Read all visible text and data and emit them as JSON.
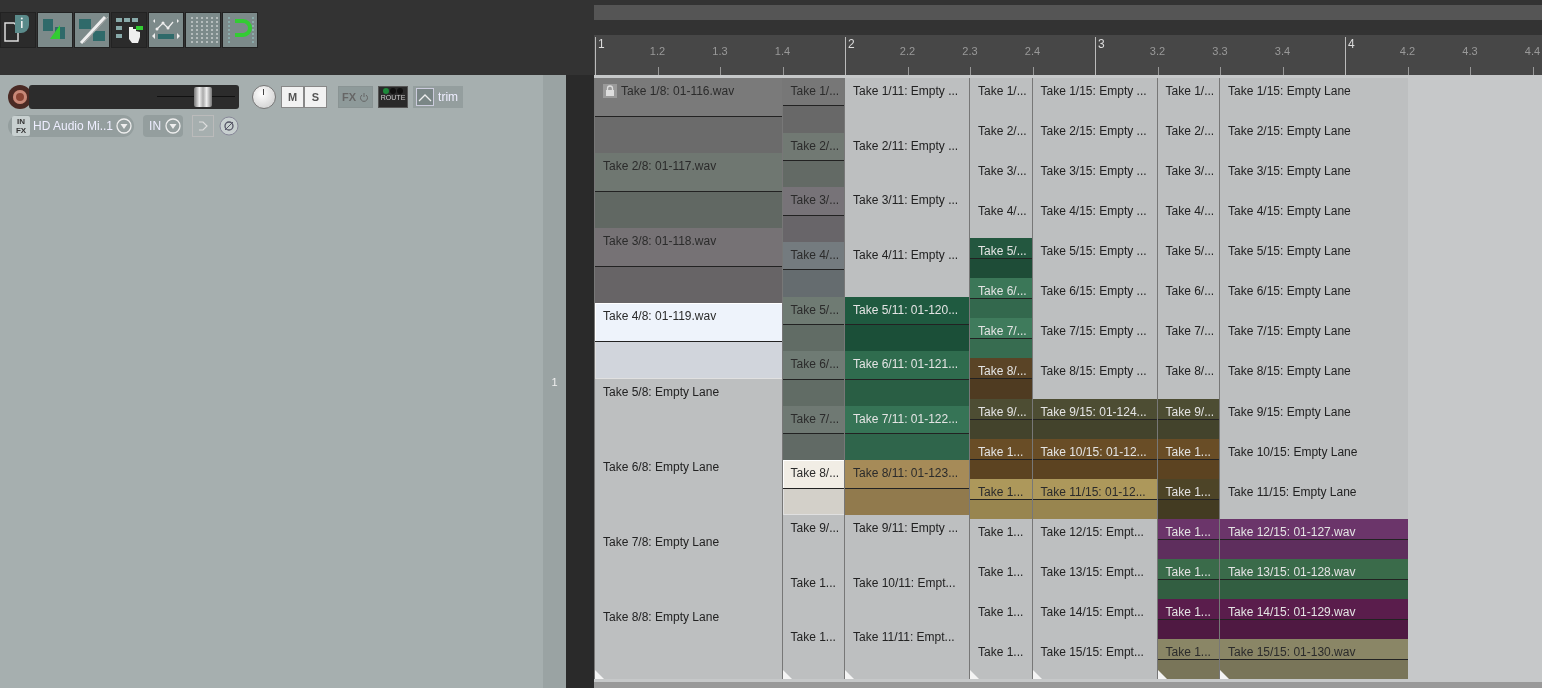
{
  "toolbar": {
    "buttons": [
      {
        "kind": "info",
        "on": false
      },
      {
        "kind": "snap",
        "on": true
      },
      {
        "kind": "ripple",
        "on": true
      },
      {
        "kind": "grid-select",
        "on": false
      },
      {
        "kind": "envelope",
        "on": true
      },
      {
        "kind": "grid",
        "on": true
      },
      {
        "kind": "loop",
        "on": true
      }
    ]
  },
  "track": {
    "number": "1",
    "record_armed": false,
    "volume": {
      "level": 0.86
    },
    "mute": {
      "label": "M",
      "on": false
    },
    "solo": {
      "label": "S",
      "on": false
    },
    "fx": {
      "label": "FX"
    },
    "route": {
      "label": "ROUTE"
    },
    "automation": {
      "label": "trim"
    },
    "input": {
      "badge_top": "IN",
      "badge_bottom": "FX",
      "value": "HD Audio Mi..1"
    },
    "monitor": {
      "value": "IN"
    }
  },
  "ruler": {
    "labels": [
      {
        "text": "1",
        "kind": "measure"
      },
      {
        "text": "1.2",
        "kind": "beat"
      },
      {
        "text": "1.3",
        "kind": "beat"
      },
      {
        "text": "1.4",
        "kind": "beat"
      },
      {
        "text": "2",
        "kind": "measure"
      },
      {
        "text": "2.2",
        "kind": "beat"
      },
      {
        "text": "2.3",
        "kind": "beat"
      },
      {
        "text": "2.4",
        "kind": "beat"
      },
      {
        "text": "3",
        "kind": "measure"
      },
      {
        "text": "3.2",
        "kind": "beat"
      },
      {
        "text": "3.3",
        "kind": "beat"
      },
      {
        "text": "3.4",
        "kind": "beat"
      },
      {
        "text": "4",
        "kind": "measure"
      },
      {
        "text": "4.2",
        "kind": "beat"
      },
      {
        "text": "4.3",
        "kind": "beat"
      },
      {
        "text": "4.4",
        "kind": "beat"
      }
    ]
  },
  "arrange": {
    "items": [
      {
        "locked": true,
        "takes": [
          {
            "label": "Take 1/8: 01-116.wav",
            "kind": "audio",
            "color": "#7a7a7a",
            "selected": false
          },
          {
            "label": "Take 2/8: 01-117.wav",
            "kind": "audio",
            "color": "#6f7771",
            "selected": false
          },
          {
            "label": "Take 3/8: 01-118.wav",
            "kind": "audio",
            "color": "#767275",
            "selected": false
          },
          {
            "label": "Take 4/8: 01-119.wav",
            "kind": "audio",
            "color": "#eef3fb",
            "selected": true
          },
          {
            "label": "Take 5/8: Empty Lane",
            "kind": "empty",
            "selected": false
          },
          {
            "label": "Take 6/8: Empty Lane",
            "kind": "empty",
            "selected": false
          },
          {
            "label": "Take 7/8: Empty Lane",
            "kind": "empty",
            "selected": false
          },
          {
            "label": "Take 8/8: Empty Lane",
            "kind": "empty",
            "selected": false
          }
        ]
      },
      {
        "locked": false,
        "takes": [
          {
            "label": "Take 1/...",
            "kind": "audio",
            "color": "#777777",
            "selected": false
          },
          {
            "label": "Take 2/...",
            "kind": "audio",
            "color": "#717973",
            "selected": false
          },
          {
            "label": "Take 3/...",
            "kind": "audio",
            "color": "#777378",
            "selected": false
          },
          {
            "label": "Take 4/...",
            "kind": "audio",
            "color": "#747b7f",
            "selected": false
          },
          {
            "label": "Take 5/...",
            "kind": "audio",
            "color": "#6f7b73",
            "selected": false
          },
          {
            "label": "Take 6/...",
            "kind": "audio",
            "color": "#6f7b74",
            "selected": false
          },
          {
            "label": "Take 7/...",
            "kind": "audio",
            "color": "#6f7973",
            "selected": false
          },
          {
            "label": "Take 8/...",
            "kind": "audio",
            "color": "#f1ede5",
            "selected": true
          },
          {
            "label": "Take 9/...",
            "kind": "empty",
            "selected": false
          },
          {
            "label": "Take 1...",
            "kind": "empty",
            "selected": false
          },
          {
            "label": "Take 1...",
            "kind": "empty",
            "selected": false
          }
        ]
      },
      {
        "locked": false,
        "takes": [
          {
            "label": "Take 1/11: Empty ...",
            "kind": "empty",
            "selected": false
          },
          {
            "label": "Take 2/11: Empty ...",
            "kind": "empty",
            "selected": false
          },
          {
            "label": "Take 3/11: Empty ...",
            "kind": "empty",
            "selected": false
          },
          {
            "label": "Take 4/11: Empty ...",
            "kind": "empty",
            "selected": false
          },
          {
            "label": "Take 5/11: 01-120...",
            "kind": "audio",
            "color": "#1f5a40",
            "selected": false
          },
          {
            "label": "Take 6/11: 01-121...",
            "kind": "audio",
            "color": "#2f6c4e",
            "selected": false
          },
          {
            "label": "Take 7/11: 01-122...",
            "kind": "audio",
            "color": "#367456",
            "selected": false
          },
          {
            "label": "Take 8/11: 01-123...",
            "kind": "audio",
            "color": "#a68b58",
            "selected": false
          },
          {
            "label": "Take 9/11: Empty ...",
            "kind": "empty",
            "selected": false
          },
          {
            "label": "Take 10/11: Empt...",
            "kind": "empty",
            "selected": false
          },
          {
            "label": "Take 11/11: Empt...",
            "kind": "empty",
            "selected": false
          }
        ]
      },
      {
        "locked": false,
        "takes": [
          {
            "label": "Take 1/...",
            "kind": "empty",
            "selected": false
          },
          {
            "label": "Take 2/...",
            "kind": "empty",
            "selected": false
          },
          {
            "label": "Take 3/...",
            "kind": "empty",
            "selected": false
          },
          {
            "label": "Take 4/...",
            "kind": "empty",
            "selected": false
          },
          {
            "label": "Take 5/...",
            "kind": "audio",
            "color": "#23573f",
            "selected": false
          },
          {
            "label": "Take 6/...",
            "kind": "audio",
            "color": "#3b7758",
            "selected": false
          },
          {
            "label": "Take 7/...",
            "kind": "audio",
            "color": "#3f7b5c",
            "selected": false
          },
          {
            "label": "Take 8/...",
            "kind": "audio",
            "color": "#5a4426",
            "selected": false
          },
          {
            "label": "Take 9/...",
            "kind": "audio",
            "color": "#4d4d33",
            "selected": false
          },
          {
            "label": "Take 1...",
            "kind": "audio",
            "color": "#694d26",
            "selected": false
          },
          {
            "label": "Take 1...",
            "kind": "audio",
            "color": "#ad985b",
            "selected": false
          },
          {
            "label": "Take 1...",
            "kind": "empty",
            "selected": false
          },
          {
            "label": "Take 1...",
            "kind": "empty",
            "selected": false
          },
          {
            "label": "Take 1...",
            "kind": "empty",
            "selected": false
          },
          {
            "label": "Take 1...",
            "kind": "empty",
            "selected": false
          }
        ]
      },
      {
        "locked": false,
        "takes": [
          {
            "label": "Take 1/15: Empty ...",
            "kind": "empty",
            "selected": false
          },
          {
            "label": "Take 2/15: Empty ...",
            "kind": "empty",
            "selected": false
          },
          {
            "label": "Take 3/15: Empty ...",
            "kind": "empty",
            "selected": false
          },
          {
            "label": "Take 4/15: Empty ...",
            "kind": "empty",
            "selected": false
          },
          {
            "label": "Take 5/15: Empty ...",
            "kind": "empty",
            "selected": false
          },
          {
            "label": "Take 6/15: Empty ...",
            "kind": "empty",
            "selected": false
          },
          {
            "label": "Take 7/15: Empty ...",
            "kind": "empty",
            "selected": false
          },
          {
            "label": "Take 8/15: Empty ...",
            "kind": "empty",
            "selected": false
          },
          {
            "label": "Take 9/15: 01-124...",
            "kind": "audio",
            "color": "#4d4d33",
            "selected": false
          },
          {
            "label": "Take 10/15: 01-12...",
            "kind": "audio",
            "color": "#694d26",
            "selected": false
          },
          {
            "label": "Take 11/15: 01-12...",
            "kind": "audio",
            "color": "#ad985b",
            "selected": false
          },
          {
            "label": "Take 12/15: Empt...",
            "kind": "empty",
            "selected": false
          },
          {
            "label": "Take 13/15: Empt...",
            "kind": "empty",
            "selected": false
          },
          {
            "label": "Take 14/15: Empt...",
            "kind": "empty",
            "selected": false
          },
          {
            "label": "Take 15/15: Empt...",
            "kind": "empty",
            "selected": false
          }
        ]
      },
      {
        "locked": false,
        "takes": [
          {
            "label": "Take 1/...",
            "kind": "empty",
            "selected": false
          },
          {
            "label": "Take 2/...",
            "kind": "empty",
            "selected": false
          },
          {
            "label": "Take 3/...",
            "kind": "empty",
            "selected": false
          },
          {
            "label": "Take 4/...",
            "kind": "empty",
            "selected": false
          },
          {
            "label": "Take 5/...",
            "kind": "empty",
            "selected": false
          },
          {
            "label": "Take 6/...",
            "kind": "empty",
            "selected": false
          },
          {
            "label": "Take 7/...",
            "kind": "empty",
            "selected": false
          },
          {
            "label": "Take 8/...",
            "kind": "empty",
            "selected": false
          },
          {
            "label": "Take 9/...",
            "kind": "audio",
            "color": "#4d4d33",
            "selected": false
          },
          {
            "label": "Take 1...",
            "kind": "audio",
            "color": "#694d26",
            "selected": false
          },
          {
            "label": "Take 1...",
            "kind": "audio",
            "color": "#4d4427",
            "selected": false
          },
          {
            "label": "Take 1...",
            "kind": "audio",
            "color": "#6b356a",
            "selected": false
          },
          {
            "label": "Take 1...",
            "kind": "audio",
            "color": "#3a6b4a",
            "selected": false
          },
          {
            "label": "Take 1...",
            "kind": "audio",
            "color": "#5a1d4c",
            "selected": false
          },
          {
            "label": "Take 1...",
            "kind": "audio",
            "color": "#8a8666",
            "selected": false
          }
        ]
      },
      {
        "locked": false,
        "takes": [
          {
            "label": "Take 1/15: Empty Lane",
            "kind": "empty",
            "selected": false
          },
          {
            "label": "Take 2/15: Empty Lane",
            "kind": "empty",
            "selected": false
          },
          {
            "label": "Take 3/15: Empty Lane",
            "kind": "empty",
            "selected": false
          },
          {
            "label": "Take 4/15: Empty Lane",
            "kind": "empty",
            "selected": false
          },
          {
            "label": "Take 5/15: Empty Lane",
            "kind": "empty",
            "selected": false
          },
          {
            "label": "Take 6/15: Empty Lane",
            "kind": "empty",
            "selected": false
          },
          {
            "label": "Take 7/15: Empty Lane",
            "kind": "empty",
            "selected": false
          },
          {
            "label": "Take 8/15: Empty Lane",
            "kind": "empty",
            "selected": false
          },
          {
            "label": "Take 9/15: Empty Lane",
            "kind": "empty",
            "selected": false
          },
          {
            "label": "Take 10/15: Empty Lane",
            "kind": "empty",
            "selected": false
          },
          {
            "label": "Take 11/15: Empty Lane",
            "kind": "empty",
            "selected": false
          },
          {
            "label": "Take 12/15: 01-127.wav",
            "kind": "audio",
            "color": "#6b356a",
            "selected": false
          },
          {
            "label": "Take 13/15: 01-128.wav",
            "kind": "audio",
            "color": "#3a6b4a",
            "selected": false
          },
          {
            "label": "Take 14/15: 01-129.wav",
            "kind": "audio",
            "color": "#5a1d4c",
            "selected": false
          },
          {
            "label": "Take 15/15: 01-130.wav",
            "kind": "audio",
            "color": "#8a8666",
            "selected": false
          }
        ]
      }
    ]
  }
}
